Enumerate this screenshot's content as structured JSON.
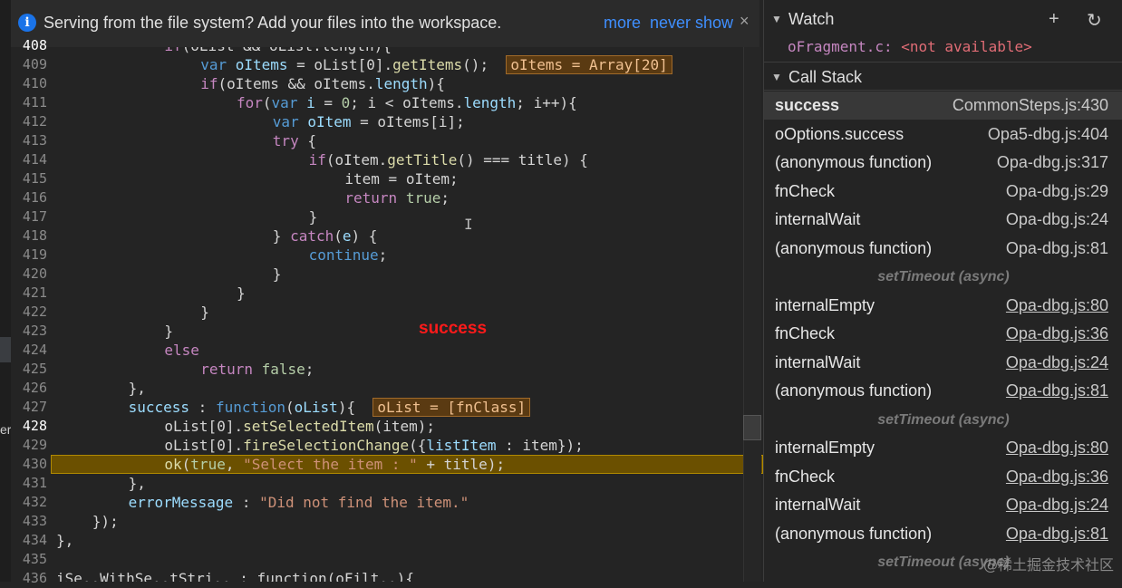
{
  "infobar": {
    "message": "Serving from the file system? Add your files into the workspace.",
    "more": "more",
    "never_show": "never show",
    "close": "×"
  },
  "left_strip": {
    "cut_text": "er"
  },
  "editor": {
    "overlay_text": "success",
    "lines": [
      {
        "n": "408",
        "bp": true,
        "indent": 6,
        "tokens": [
          [
            "kw",
            "if"
          ],
          [
            "",
            "(oList && oList.length){"
          ]
        ]
      },
      {
        "n": "409",
        "bp": false,
        "indent": 8,
        "tokens": [
          [
            "kw2",
            "var "
          ],
          [
            "var",
            "oItems"
          ],
          [
            "",
            " = oList[0]."
          ],
          [
            "fn",
            "getItems"
          ],
          [
            "",
            "();  "
          ],
          [
            "inl",
            "oItems = Array[20]"
          ]
        ]
      },
      {
        "n": "410",
        "bp": false,
        "indent": 8,
        "tokens": [
          [
            "kw",
            "if"
          ],
          [
            "",
            "(oItems && oItems."
          ],
          [
            "var",
            "length"
          ],
          [
            "",
            "){"
          ]
        ]
      },
      {
        "n": "411",
        "bp": false,
        "indent": 10,
        "tokens": [
          [
            "kw",
            "for"
          ],
          [
            "",
            "("
          ],
          [
            "kw2",
            "var "
          ],
          [
            "var",
            "i"
          ],
          [
            "",
            " = "
          ],
          [
            "num",
            "0"
          ],
          [
            "",
            "; i < oItems."
          ],
          [
            "var",
            "length"
          ],
          [
            "",
            "; i++){"
          ]
        ]
      },
      {
        "n": "412",
        "bp": false,
        "indent": 12,
        "tokens": [
          [
            "kw2",
            "var "
          ],
          [
            "var",
            "oItem"
          ],
          [
            "",
            " = oItems[i];"
          ]
        ]
      },
      {
        "n": "413",
        "bp": false,
        "indent": 12,
        "tokens": [
          [
            "kw",
            "try"
          ],
          [
            "",
            " {"
          ]
        ]
      },
      {
        "n": "414",
        "bp": false,
        "indent": 14,
        "tokens": [
          [
            "kw",
            "if"
          ],
          [
            "",
            "(oItem."
          ],
          [
            "fn",
            "getTitle"
          ],
          [
            "",
            "() === title) {"
          ]
        ]
      },
      {
        "n": "415",
        "bp": false,
        "indent": 16,
        "tokens": [
          [
            "",
            "item = oItem;"
          ]
        ]
      },
      {
        "n": "416",
        "bp": false,
        "indent": 16,
        "tokens": [
          [
            "kw",
            "return "
          ],
          [
            "num",
            "true"
          ],
          [
            "",
            ";"
          ]
        ]
      },
      {
        "n": "417",
        "bp": false,
        "indent": 14,
        "tokens": [
          [
            "",
            "}"
          ]
        ]
      },
      {
        "n": "418",
        "bp": false,
        "indent": 12,
        "tokens": [
          [
            "",
            "} "
          ],
          [
            "kw",
            "catch"
          ],
          [
            "",
            "("
          ],
          [
            "var",
            "e"
          ],
          [
            "",
            ") {"
          ]
        ]
      },
      {
        "n": "419",
        "bp": false,
        "indent": 14,
        "tokens": [
          [
            "kw2",
            "continue"
          ],
          [
            "",
            ";"
          ]
        ]
      },
      {
        "n": "420",
        "bp": false,
        "indent": 12,
        "tokens": [
          [
            "",
            "}"
          ]
        ]
      },
      {
        "n": "421",
        "bp": false,
        "indent": 10,
        "tokens": [
          [
            "",
            "}"
          ]
        ]
      },
      {
        "n": "422",
        "bp": false,
        "indent": 8,
        "tokens": [
          [
            "",
            "}"
          ]
        ]
      },
      {
        "n": "423",
        "bp": false,
        "indent": 6,
        "tokens": [
          [
            "",
            "}"
          ]
        ]
      },
      {
        "n": "424",
        "bp": false,
        "indent": 6,
        "tokens": [
          [
            "kw",
            "else"
          ]
        ]
      },
      {
        "n": "425",
        "bp": false,
        "indent": 8,
        "tokens": [
          [
            "kw",
            "return "
          ],
          [
            "num",
            "false"
          ],
          [
            "",
            ";"
          ]
        ]
      },
      {
        "n": "426",
        "bp": false,
        "indent": 4,
        "tokens": [
          [
            "",
            "},"
          ]
        ]
      },
      {
        "n": "427",
        "bp": false,
        "indent": 4,
        "tokens": [
          [
            "var",
            "success"
          ],
          [
            "",
            " : "
          ],
          [
            "kw2",
            "function"
          ],
          [
            "",
            "("
          ],
          [
            "var",
            "oList"
          ],
          [
            "",
            "){  "
          ],
          [
            "inl",
            "oList = [fnClass]"
          ]
        ]
      },
      {
        "n": "428",
        "bp": true,
        "indent": 6,
        "tokens": [
          [
            "",
            "oList[0]."
          ],
          [
            "fn",
            "setSelectedItem"
          ],
          [
            "",
            "(item);"
          ]
        ]
      },
      {
        "n": "429",
        "bp": false,
        "indent": 6,
        "tokens": [
          [
            "",
            "oList[0]."
          ],
          [
            "fn",
            "fireSelectionChange"
          ],
          [
            "",
            "({"
          ],
          [
            "var",
            "listItem"
          ],
          [
            "",
            " : item});"
          ]
        ]
      },
      {
        "n": "430",
        "bp": false,
        "indent": 6,
        "current": true,
        "tokens": [
          [
            "fn",
            "ok"
          ],
          [
            "",
            "("
          ],
          [
            "num",
            "true"
          ],
          [
            "",
            ", "
          ],
          [
            "str",
            "\"Select the item : \""
          ],
          [
            "",
            " + title);"
          ]
        ]
      },
      {
        "n": "431",
        "bp": false,
        "indent": 4,
        "tokens": [
          [
            "",
            "},"
          ]
        ]
      },
      {
        "n": "432",
        "bp": false,
        "indent": 4,
        "tokens": [
          [
            "var",
            "errorMessage"
          ],
          [
            "",
            " : "
          ],
          [
            "str",
            "\"Did not find the item.\""
          ]
        ]
      },
      {
        "n": "433",
        "bp": false,
        "indent": 2,
        "tokens": [
          [
            "",
            "});"
          ]
        ]
      },
      {
        "n": "434",
        "bp": false,
        "indent": 0,
        "tokens": [
          [
            "",
            "},"
          ]
        ]
      },
      {
        "n": "435",
        "bp": false,
        "indent": 0,
        "tokens": [
          [
            "",
            ""
          ]
        ]
      },
      {
        "n": "436",
        "bp": false,
        "indent": 0,
        "tokens": [
          [
            "",
            "iSe..WithSe..tStri.. : function(oFilt..){"
          ]
        ]
      }
    ]
  },
  "watch": {
    "title": "Watch",
    "add_icon": "+",
    "refresh_icon": "↻",
    "expression_name": "oFragment.c:",
    "expression_value": "<not available>"
  },
  "call_stack": {
    "title": "Call Stack",
    "items": [
      {
        "type": "frame",
        "name": "success",
        "loc": "CommonSteps.js:430",
        "active": true,
        "ul": false
      },
      {
        "type": "frame",
        "name": "oOptions.success",
        "loc": "Opa5-dbg.js:404",
        "ul": false
      },
      {
        "type": "frame",
        "name": "(anonymous function)",
        "loc": "Opa-dbg.js:317",
        "ul": false
      },
      {
        "type": "frame",
        "name": "fnCheck",
        "loc": "Opa-dbg.js:29",
        "ul": false
      },
      {
        "type": "frame",
        "name": "internalWait",
        "loc": "Opa-dbg.js:24",
        "ul": false
      },
      {
        "type": "frame",
        "name": "(anonymous function)",
        "loc": "Opa-dbg.js:81",
        "ul": false
      },
      {
        "type": "async",
        "name": "setTimeout (async)"
      },
      {
        "type": "frame",
        "name": "internalEmpty",
        "loc": "Opa-dbg.js:80",
        "ul": true
      },
      {
        "type": "frame",
        "name": "fnCheck",
        "loc": "Opa-dbg.js:36",
        "ul": true
      },
      {
        "type": "frame",
        "name": "internalWait",
        "loc": "Opa-dbg.js:24",
        "ul": true
      },
      {
        "type": "frame",
        "name": "(anonymous function)",
        "loc": "Opa-dbg.js:81",
        "ul": true
      },
      {
        "type": "async",
        "name": "setTimeout (async)"
      },
      {
        "type": "frame",
        "name": "internalEmpty",
        "loc": "Opa-dbg.js:80",
        "ul": true
      },
      {
        "type": "frame",
        "name": "fnCheck",
        "loc": "Opa-dbg.js:36",
        "ul": true
      },
      {
        "type": "frame",
        "name": "internalWait",
        "loc": "Opa-dbg.js:24",
        "ul": true
      },
      {
        "type": "frame",
        "name": "(anonymous function)",
        "loc": "Opa-dbg.js:81",
        "ul": true
      },
      {
        "type": "async",
        "name": "setTimeout (async)"
      }
    ]
  },
  "watermark": "@稀土掘金技术社区"
}
